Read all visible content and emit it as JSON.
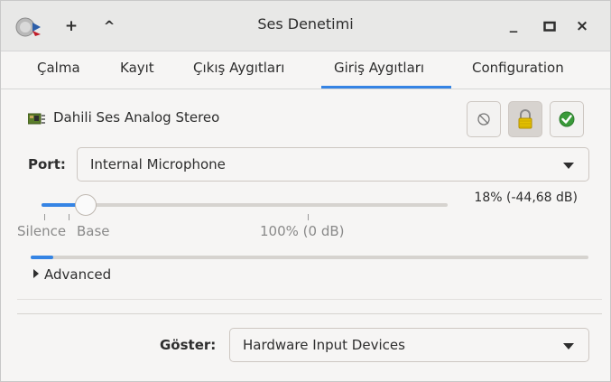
{
  "window": {
    "title": "Ses Denetimi",
    "buttons": [
      "+",
      "^",
      "_",
      "□",
      "×"
    ]
  },
  "tabs": [
    {
      "label": "Çalma"
    },
    {
      "label": "Kayıt"
    },
    {
      "label": "Çıkış Aygıtları"
    },
    {
      "label": "Giriş Aygıtları",
      "selected": true
    },
    {
      "label": "Configuration"
    }
  ],
  "device": {
    "name": "Dahili Ses Analog Stereo",
    "icon": "sound-card-icon",
    "buttons": [
      {
        "name": "mute-button",
        "icon": "mute-icon"
      },
      {
        "name": "lock-channels-button",
        "icon": "lock-icon",
        "active": true
      },
      {
        "name": "set-fallback-button",
        "icon": "check-icon"
      }
    ]
  },
  "port": {
    "label": "Port:",
    "selected": "Internal Microphone"
  },
  "volume": {
    "readout": "18% (-44,68 dB)",
    "percent": 18,
    "marks": [
      "Silence",
      "Base",
      "100% (0 dB)"
    ]
  },
  "meter": {
    "level_percent": 4
  },
  "advanced": {
    "label": "Advanced"
  },
  "show_filter": {
    "label": "Göster:",
    "selected": "Hardware Input Devices"
  },
  "colors": {
    "accent": "#3584e4",
    "check_green": "#26a269"
  }
}
